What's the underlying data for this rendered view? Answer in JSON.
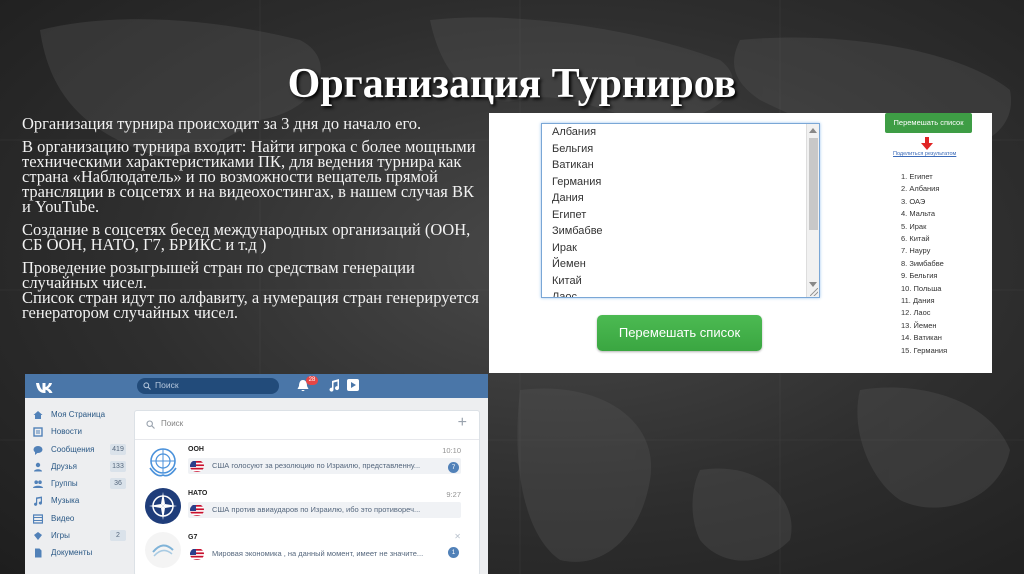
{
  "slide": {
    "title": "Организация Турниров",
    "paragraphs": [
      "Организация турнира происходит за 3 дня до начало его.",
      "В организацию турнира входит: Найти игрока с более мощными техническими характеристиками ПК, для ведения турнира как страна «Наблюдатель» и по возможности вещатель прямой трансляции в соцсетях и на видеохостингах, в нашем случая ВК и YouTube.",
      "Создание в соцсетях бесед международных организаций (ООН, СБ ООН, НАТО, Г7, БРИКС и т.д )",
      "Проведение розыгрышей стран по средствам генерации случайных чисел.",
      "Список стран идут по алфавиту, а нумерация стран генерируется генератором случайных чисел."
    ]
  },
  "shuffle": {
    "list_items": [
      "Албания",
      "Бельгия",
      "Ватикан",
      "Германия",
      "Дания",
      "Египет",
      "Зимбабве",
      "Ирак",
      "Йемен",
      "Китай",
      "Лаос"
    ],
    "button_label": "Перемешать список",
    "small_button_label": "Перемешать список",
    "share_link": "Поделиться результатом",
    "results": [
      "1. Египет",
      "2. Албания",
      "3. ОАЭ",
      "4. Мальта",
      "5. Ирак",
      "6. Китай",
      "7. Науру",
      "8. Зимбабве",
      "9. Бельгия",
      "10. Польша",
      "11. Дания",
      "12. Лаос",
      "13. Йемен",
      "14. Ватикан",
      "15. Германия"
    ]
  },
  "vk": {
    "search_placeholder": "Поиск",
    "notification_count": "28",
    "sidebar": [
      {
        "label": "Моя Страница",
        "icon": "home-icon",
        "count": ""
      },
      {
        "label": "Новости",
        "icon": "news-icon",
        "count": ""
      },
      {
        "label": "Сообщения",
        "icon": "messages-icon",
        "count": "419"
      },
      {
        "label": "Друзья",
        "icon": "friends-icon",
        "count": "133"
      },
      {
        "label": "Группы",
        "icon": "groups-icon",
        "count": "36"
      },
      {
        "label": "Музыка",
        "icon": "music-icon",
        "count": ""
      },
      {
        "label": "Видео",
        "icon": "video-icon",
        "count": ""
      },
      {
        "label": "Игры",
        "icon": "games-icon",
        "count": "2"
      },
      {
        "label": "Документы",
        "icon": "documents-icon",
        "count": ""
      }
    ],
    "messages_search_placeholder": "Поиск",
    "dialogs": [
      {
        "name": "ООН",
        "time": "10:10",
        "message": "США голосуют за резолюцию по Израилю, представленну...",
        "unread": "7"
      },
      {
        "name": "НАТО",
        "time": "9:27",
        "message": "США против авиаударов по Израилю, ибо это противореч...",
        "unread": ""
      },
      {
        "name": "G7",
        "time": "",
        "message": "Мировая экономика , на данный момент, имеет не значите...",
        "unread": "1"
      }
    ]
  },
  "colors": {
    "vk_header": "#4a76a8",
    "green_button": "#3aa641",
    "link_blue": "#2a5885"
  }
}
